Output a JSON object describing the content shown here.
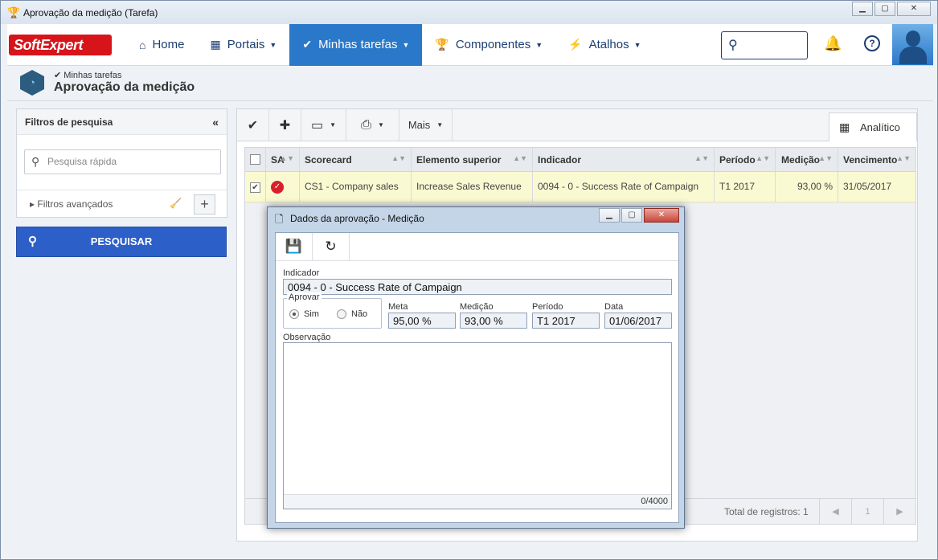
{
  "window": {
    "title": "Aprovação da medição (Tarefa)"
  },
  "nav": {
    "logo": "SoftExpert",
    "items": [
      {
        "label": "Home",
        "icon": "home-icon"
      },
      {
        "label": "Portais",
        "icon": "grid-icon"
      },
      {
        "label": "Minhas tarefas",
        "icon": "check-icon"
      },
      {
        "label": "Componentes",
        "icon": "trophy-icon"
      },
      {
        "label": "Atalhos",
        "icon": "bolt-icon"
      }
    ]
  },
  "breadcrumb": {
    "parent": "Minhas tarefas",
    "title": "Aprovação da medição"
  },
  "filters": {
    "title": "Filtros de pesquisa",
    "quick_placeholder": "Pesquisa rápida",
    "advanced": "Filtros avançados",
    "search_button": "PESQUISAR"
  },
  "toolbar": {
    "mais": "Mais",
    "tab_analitico": "Analítico"
  },
  "grid": {
    "columns": [
      "SA",
      "Scorecard",
      "Elemento superior",
      "Indicador",
      "Período",
      "Medição",
      "Vencimento"
    ],
    "rows": [
      {
        "scorecard": "CS1 - Company sales",
        "elemento": "Increase Sales Revenue",
        "indicador": "0094 - 0 - Success Rate of Campaign",
        "periodo": "T1 2017",
        "medicao": "93,00 %",
        "vencimento": "31/05/2017"
      }
    ],
    "total": "Total de registros: 1",
    "page": "1"
  },
  "modal": {
    "title": "Dados da aprovação - Medição",
    "indicador_label": "Indicador",
    "indicador_value": "0094 - 0 - Success Rate of Campaign",
    "aprovar_label": "Aprovar",
    "sim": "Sim",
    "nao": "Não",
    "meta_label": "Meta",
    "meta_value": "95,00 %",
    "medicao_label": "Medição",
    "medicao_value": "93,00 %",
    "periodo_label": "Período",
    "periodo_value": "T1 2017",
    "data_label": "Data",
    "data_value": "01/06/2017",
    "observacao_label": "Observação",
    "counter": "0/4000"
  }
}
